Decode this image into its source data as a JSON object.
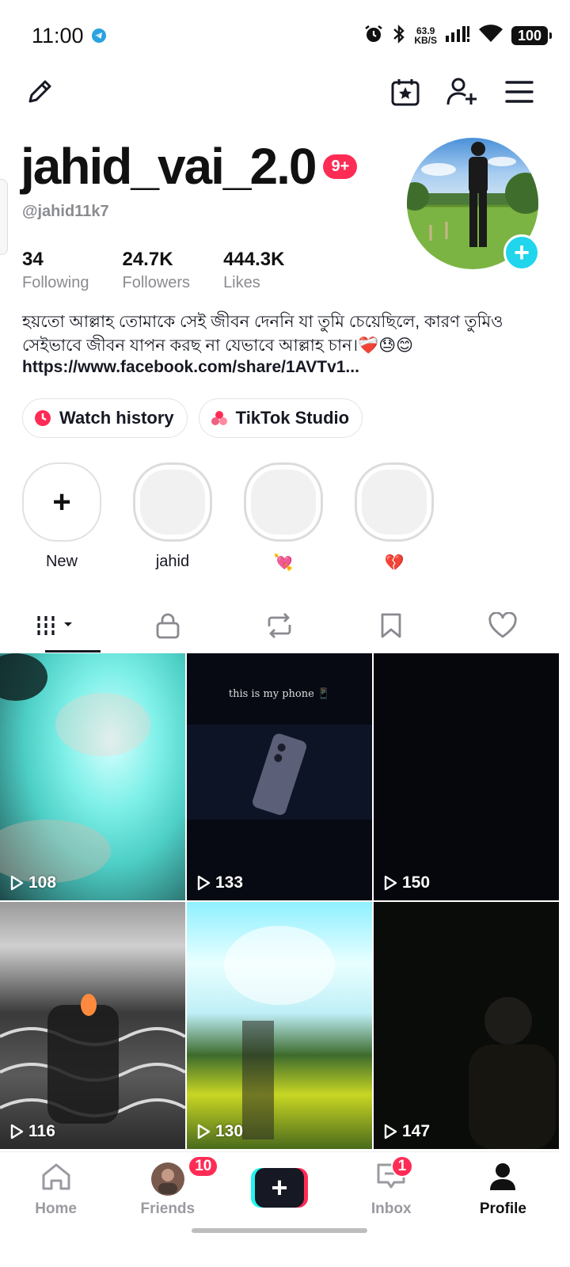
{
  "status_bar": {
    "time": "11:00",
    "net_speed_value": "63.9",
    "net_speed_unit": "KB/S",
    "battery": "100",
    "icons": [
      "telegram-icon",
      "alarm-icon",
      "bluetooth-icon",
      "signal-icon",
      "wifi-icon",
      "battery-icon"
    ]
  },
  "toolbar": {
    "icons": [
      "edit-pencil-icon",
      "calendar-star-icon",
      "add-friend-icon",
      "menu-icon"
    ]
  },
  "profile": {
    "username": "jahid_vai_2.0",
    "notification_badge": "9+",
    "handle": "@jahid11k7",
    "stats": [
      {
        "value": "34",
        "label": "Following"
      },
      {
        "value": "24.7K",
        "label": "Followers"
      },
      {
        "value": "444.3K",
        "label": "Likes"
      }
    ],
    "bio_line1": "হয়তো আল্লাহ তোমাকে সেই জীবন দেননি যা তুমি চেয়েছিলে, কারণ তুমিও",
    "bio_line2": "সেইভাবে জীবন যাপন করছ না যেভাবে আল্লাহ চান।❤️‍🩹😓😊",
    "link": "https://www.facebook.com/share/1AVTv1..."
  },
  "buttons": {
    "watch_history": "Watch history",
    "tiktok_studio": "TikTok Studio"
  },
  "highlights": [
    {
      "label": "New"
    },
    {
      "label": "jahid"
    },
    {
      "label": "💘"
    },
    {
      "label": "💔"
    }
  ],
  "tabs": [
    "videos-grid-icon",
    "private-lock-icon",
    "repost-icon",
    "bookmark-icon",
    "liked-heart-icon"
  ],
  "videos": [
    {
      "views": "108"
    },
    {
      "views": "133",
      "caption": "this is my phone 📱"
    },
    {
      "views": "150"
    },
    {
      "views": "116"
    },
    {
      "views": "130"
    },
    {
      "views": "147"
    }
  ],
  "bottom_nav": {
    "home": "Home",
    "friends": "Friends",
    "friends_badge": "10",
    "inbox": "Inbox",
    "inbox_badge": "1",
    "profile": "Profile"
  },
  "colors": {
    "accent_red": "#fe2c55",
    "accent_cyan": "#20d5ec",
    "text_dark": "#161823",
    "text_muted": "#8a8b91"
  }
}
